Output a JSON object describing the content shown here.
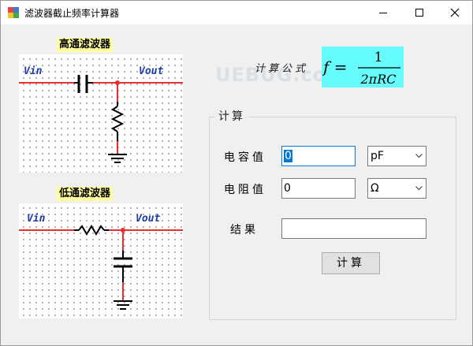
{
  "window": {
    "title": "滤波器截止频率计算器",
    "controls": [
      "minimize",
      "maximize",
      "close"
    ]
  },
  "high_pass": {
    "header": "高通滤波器",
    "in_label": "Vin",
    "out_label": "Vout"
  },
  "low_pass": {
    "header": "低通滤波器",
    "in_label": "Vin",
    "out_label": "Vout"
  },
  "formula": {
    "label": "计算公式",
    "lhs": "f =",
    "numerator": "1",
    "denominator": "2πRC",
    "watermark": "UEBUG.com"
  },
  "calc": {
    "group_title": "计算",
    "capacitance_label": "电容值",
    "capacitance_value": "0",
    "capacitance_unit": "pF",
    "resistance_label": "电阻值",
    "resistance_value": "0",
    "resistance_unit": "Ω",
    "result_label": "结果",
    "result_value": "",
    "button_label": "计算"
  },
  "colors": {
    "header_bg": "#ffffa0",
    "formula_bg": "#66fcfc",
    "wire": "#e53030",
    "net_label": "#1e3ca8",
    "focus": "#0078d7"
  }
}
